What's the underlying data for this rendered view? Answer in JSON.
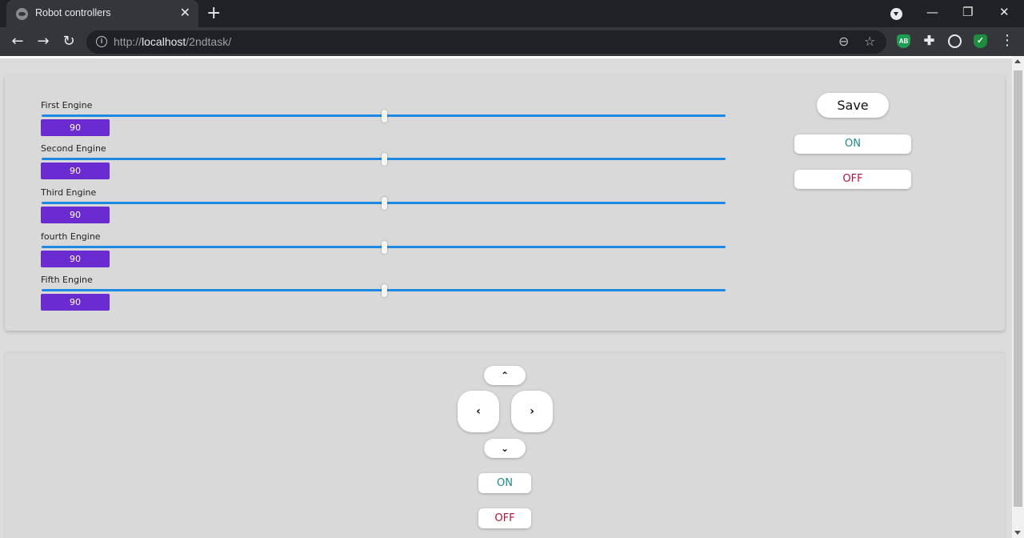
{
  "browser": {
    "tab_title": "Robot controllers",
    "tab_close": "✕",
    "new_tab": "+",
    "url_prefix": "http://",
    "url_host": "localhost",
    "url_path": "/2ndtask/",
    "window_minimize": "—",
    "window_restore": "❐",
    "window_close": "✕",
    "extensions": [
      "AB",
      "✓"
    ]
  },
  "engines": [
    {
      "label": "First Engine",
      "value": "90"
    },
    {
      "label": "Second Engine",
      "value": "90"
    },
    {
      "label": "Third Engine",
      "value": "90"
    },
    {
      "label": "fourth Engine",
      "value": "90"
    },
    {
      "label": "Fifth Engine",
      "value": "90"
    }
  ],
  "slider": {
    "min": 0,
    "max": 180
  },
  "controls": {
    "save_label": "Save",
    "on_label": "ON",
    "off_label": "OFF"
  },
  "dpad": {
    "up": "⌃",
    "left": "‹",
    "right": "›",
    "down": "⌄",
    "on_label": "ON",
    "off_label": "OFF"
  },
  "colors": {
    "value_badge": "#6a2bd0",
    "slider_track": "#1e88e5",
    "on_text": "#1c8b8b",
    "off_text": "#b0143a"
  }
}
